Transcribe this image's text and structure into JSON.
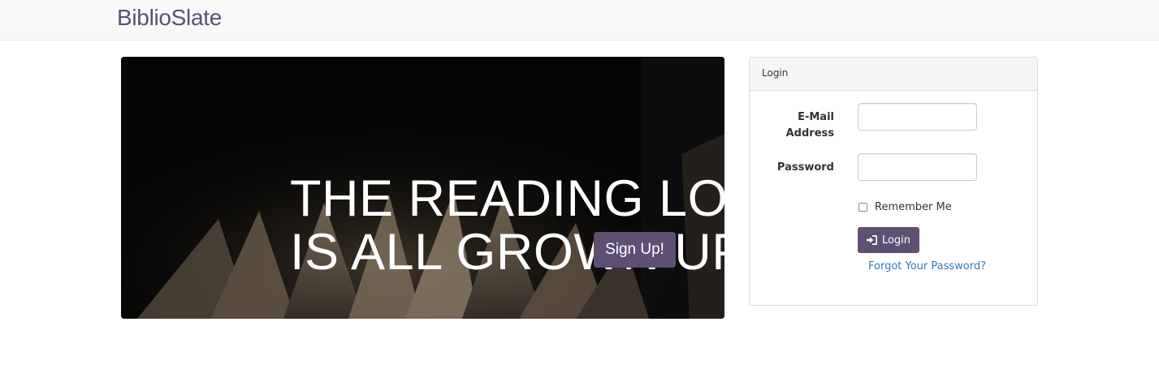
{
  "navbar": {
    "brand": "BiblioSlate"
  },
  "hero": {
    "title_line1": "THE READING LOG",
    "title_line2": "IS ALL GROWN UP",
    "signup_label": "Sign Up!"
  },
  "login": {
    "heading": "Login",
    "email_label_line1": "E-Mail",
    "email_label_line2": "Address",
    "email_value": "",
    "password_label": "Password",
    "password_value": "",
    "remember_label": "Remember Me",
    "remember_checked": false,
    "login_label": "Login",
    "login_icon": "sign-in-icon",
    "forgot_label": "Forgot Your Password?"
  },
  "colors": {
    "brand": "#5e4f73",
    "link": "#337ab7",
    "navbar_bg": "#f8f8f8",
    "hero_bg": "#060606"
  }
}
